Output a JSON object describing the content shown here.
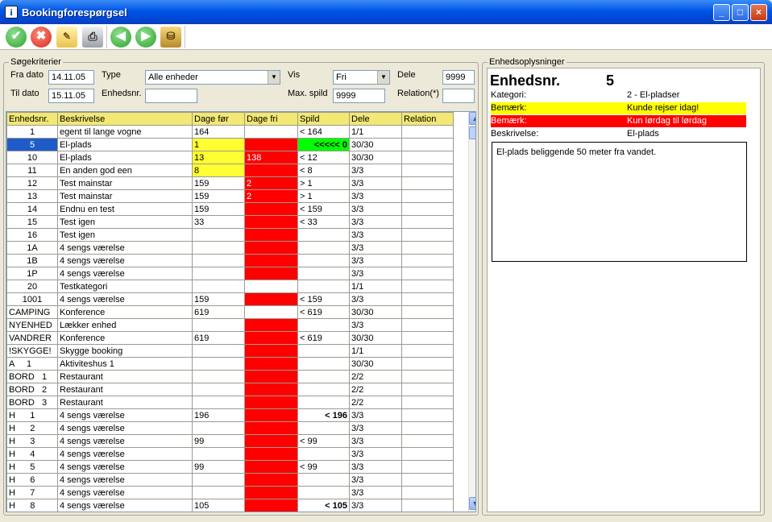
{
  "window": {
    "title": "Bookingforespørgsel",
    "icon": "info-icon"
  },
  "toolbar": {
    "buttons": [
      {
        "name": "ok-button",
        "icon": "check-icon",
        "color": "#2fa22f"
      },
      {
        "name": "cancel-button",
        "icon": "x-icon",
        "color": "#d42a1e"
      },
      {
        "name": "notes-button",
        "icon": "notes-icon",
        "color": "#e9c44a"
      },
      {
        "name": "print-button",
        "icon": "printer-icon",
        "color": "#9aa0a8"
      },
      {
        "name": "back-button",
        "icon": "arrow-left-icon",
        "color": "#2fa22f"
      },
      {
        "name": "forward-button",
        "icon": "arrow-right-icon",
        "color": "#2fa22f"
      },
      {
        "name": "coins-button",
        "icon": "coins-icon",
        "color": "#b8892b"
      }
    ]
  },
  "search": {
    "group_label": "Søgekriterier",
    "from_label": "Fra dato",
    "from_value": "14.11.05",
    "to_label": "Til dato",
    "to_value": "15.11.05",
    "type_label": "Type",
    "type_value": "Alle enheder",
    "unit_label": "Enhedsnr.",
    "unit_value": "",
    "show_label": "Vis",
    "show_value": "Fri",
    "max_waste_label": "Max. spild",
    "max_waste_value": "9999",
    "share_label": "Dele",
    "share_value": "9999",
    "relation_label": "Relation(*)",
    "relation_value": ""
  },
  "grid": {
    "columns": [
      "Enhedsnr.",
      "Beskrivelse",
      "Dage før",
      "Dage fri",
      "Spild",
      "Dele",
      "Relation"
    ],
    "rows": [
      {
        "unit": "1",
        "desc": "egent til lange vogne",
        "before": "164",
        "free": "",
        "waste": "< 164",
        "share": "1/1",
        "rel": "",
        "free_color": "",
        "before_color": "",
        "waste_style": ""
      },
      {
        "unit": "5",
        "desc": "El-plads",
        "before": "1",
        "free": "",
        "waste": "<<<<< 0",
        "share": "30/30",
        "rel": "",
        "free_color": "red",
        "before_color": "yel",
        "waste_style": "grn",
        "selected": true
      },
      {
        "unit": "10",
        "desc": "El-plads",
        "before": "13",
        "free": "138",
        "waste": "< 12",
        "share": "30/30",
        "rel": "",
        "free_color": "red",
        "before_color": "yel",
        "waste_style": ""
      },
      {
        "unit": "11",
        "desc": "En anden god een",
        "before": "8",
        "free": "",
        "waste": "< 8",
        "share": "3/3",
        "rel": "",
        "free_color": "red",
        "before_color": "yel",
        "waste_style": ""
      },
      {
        "unit": "12",
        "desc": "Test mainstar",
        "before": "159",
        "free": "2",
        "waste": "> 1",
        "share": "3/3",
        "rel": "",
        "free_color": "red",
        "before_color": "",
        "waste_style": ""
      },
      {
        "unit": "13",
        "desc": "Test mainstar",
        "before": "159",
        "free": "2",
        "waste": "> 1",
        "share": "3/3",
        "rel": "",
        "free_color": "red",
        "before_color": "",
        "waste_style": ""
      },
      {
        "unit": "14",
        "desc": "Endnu en test",
        "before": "159",
        "free": "",
        "waste": "< 159",
        "share": "3/3",
        "rel": "",
        "free_color": "red",
        "before_color": "",
        "waste_style": ""
      },
      {
        "unit": "15",
        "desc": "Test igen",
        "before": "33",
        "free": "",
        "waste": "< 33",
        "share": "3/3",
        "rel": "",
        "free_color": "red",
        "before_color": "",
        "waste_style": ""
      },
      {
        "unit": "16",
        "desc": "Test igen",
        "before": "",
        "free": "",
        "waste": "",
        "share": "3/3",
        "rel": "",
        "free_color": "red",
        "before_color": "",
        "waste_style": ""
      },
      {
        "unit": "1A",
        "desc": "4 sengs værelse",
        "before": "",
        "free": "",
        "waste": "",
        "share": "3/3",
        "rel": "",
        "free_color": "red",
        "before_color": "",
        "waste_style": ""
      },
      {
        "unit": "1B",
        "desc": "4 sengs værelse",
        "before": "",
        "free": "",
        "waste": "",
        "share": "3/3",
        "rel": "",
        "free_color": "red",
        "before_color": "",
        "waste_style": ""
      },
      {
        "unit": "1P",
        "desc": "4 sengs værelse",
        "before": "",
        "free": "",
        "waste": "",
        "share": "3/3",
        "rel": "",
        "free_color": "red",
        "before_color": "",
        "waste_style": ""
      },
      {
        "unit": "20",
        "desc": "Testkategori",
        "before": "",
        "free": "",
        "waste": "",
        "share": "1/1",
        "rel": "",
        "free_color": "",
        "before_color": "",
        "waste_style": ""
      },
      {
        "unit": "1001",
        "desc": "4 sengs værelse",
        "before": "159",
        "free": "",
        "waste": "< 159",
        "share": "3/3",
        "rel": "",
        "free_color": "red",
        "before_color": "",
        "waste_style": ""
      },
      {
        "unit": "CAMPING",
        "desc": "Konference",
        "before": "619",
        "free": "",
        "waste": "< 619",
        "share": "30/30",
        "rel": "",
        "free_color": "",
        "before_color": "",
        "waste_style": ""
      },
      {
        "unit": "NYENHED",
        "desc": "Lækker enhed",
        "before": "",
        "free": "",
        "waste": "",
        "share": "3/3",
        "rel": "",
        "free_color": "red",
        "before_color": "",
        "waste_style": ""
      },
      {
        "unit": "VANDRER",
        "desc": "Konference",
        "before": "619",
        "free": "",
        "waste": "< 619",
        "share": "30/30",
        "rel": "",
        "free_color": "red",
        "before_color": "",
        "waste_style": ""
      },
      {
        "unit": "!SKYGGE!",
        "desc": "Skygge booking",
        "before": "",
        "free": "",
        "waste": "",
        "share": "1/1",
        "rel": "",
        "free_color": "red",
        "before_color": "",
        "waste_style": ""
      },
      {
        "unit": "A     1",
        "desc": "Aktiviteshus 1",
        "before": "",
        "free": "",
        "waste": "",
        "share": "30/30",
        "rel": "",
        "free_color": "red",
        "before_color": "",
        "waste_style": ""
      },
      {
        "unit": "BORD   1",
        "desc": "Restaurant",
        "before": "",
        "free": "",
        "waste": "",
        "share": "2/2",
        "rel": "",
        "free_color": "red",
        "before_color": "",
        "waste_style": ""
      },
      {
        "unit": "BORD   2",
        "desc": "Restaurant",
        "before": "",
        "free": "",
        "waste": "",
        "share": "2/2",
        "rel": "",
        "free_color": "red",
        "before_color": "",
        "waste_style": ""
      },
      {
        "unit": "BORD   3",
        "desc": "Restaurant",
        "before": "",
        "free": "",
        "waste": "",
        "share": "2/2",
        "rel": "",
        "free_color": "red",
        "before_color": "",
        "waste_style": ""
      },
      {
        "unit": "H      1",
        "desc": "4 sengs værelse",
        "before": "196",
        "free": "",
        "waste": "< 196",
        "share": "3/3",
        "rel": "",
        "free_color": "red",
        "before_color": "",
        "waste_style": "boldright"
      },
      {
        "unit": "H      2",
        "desc": "4 sengs værelse",
        "before": "",
        "free": "",
        "waste": "",
        "share": "3/3",
        "rel": "",
        "free_color": "red",
        "before_color": "",
        "waste_style": ""
      },
      {
        "unit": "H      3",
        "desc": "4 sengs værelse",
        "before": "99",
        "free": "",
        "waste": "< 99",
        "share": "3/3",
        "rel": "",
        "free_color": "red",
        "before_color": "",
        "waste_style": ""
      },
      {
        "unit": "H      4",
        "desc": "4 sengs værelse",
        "before": "",
        "free": "",
        "waste": "",
        "share": "3/3",
        "rel": "",
        "free_color": "red",
        "before_color": "",
        "waste_style": ""
      },
      {
        "unit": "H      5",
        "desc": "4 sengs værelse",
        "before": "99",
        "free": "",
        "waste": "< 99",
        "share": "3/3",
        "rel": "",
        "free_color": "red",
        "before_color": "",
        "waste_style": ""
      },
      {
        "unit": "H      6",
        "desc": "4 sengs værelse",
        "before": "",
        "free": "",
        "waste": "",
        "share": "3/3",
        "rel": "",
        "free_color": "red",
        "before_color": "",
        "waste_style": ""
      },
      {
        "unit": "H      7",
        "desc": "4 sengs værelse",
        "before": "",
        "free": "",
        "waste": "",
        "share": "3/3",
        "rel": "",
        "free_color": "red",
        "before_color": "",
        "waste_style": ""
      },
      {
        "unit": "H      8",
        "desc": "4 sengs værelse",
        "before": "105",
        "free": "",
        "waste": "< 105",
        "share": "3/3",
        "rel": "",
        "free_color": "red",
        "before_color": "",
        "waste_style": "boldright"
      }
    ]
  },
  "info": {
    "group_label": "Enhedsoplysninger",
    "unit_label": "Enhedsnr.",
    "unit_value": "5",
    "category_label": "Kategori:",
    "category_value": "2 - El-pladser",
    "remark1_label": "Bemærk:",
    "remark1_value": "Kunde rejser idag!",
    "remark1_color": "#ffff00",
    "remark2_label": "Bemærk:",
    "remark2_value": "Kun lørdag til lørdag",
    "remark2_color": "#ff0000",
    "desc_label": "Beskrivelse:",
    "desc_value": "El-plads",
    "long_desc": "El-plads beliggende 50 meter fra vandet."
  }
}
